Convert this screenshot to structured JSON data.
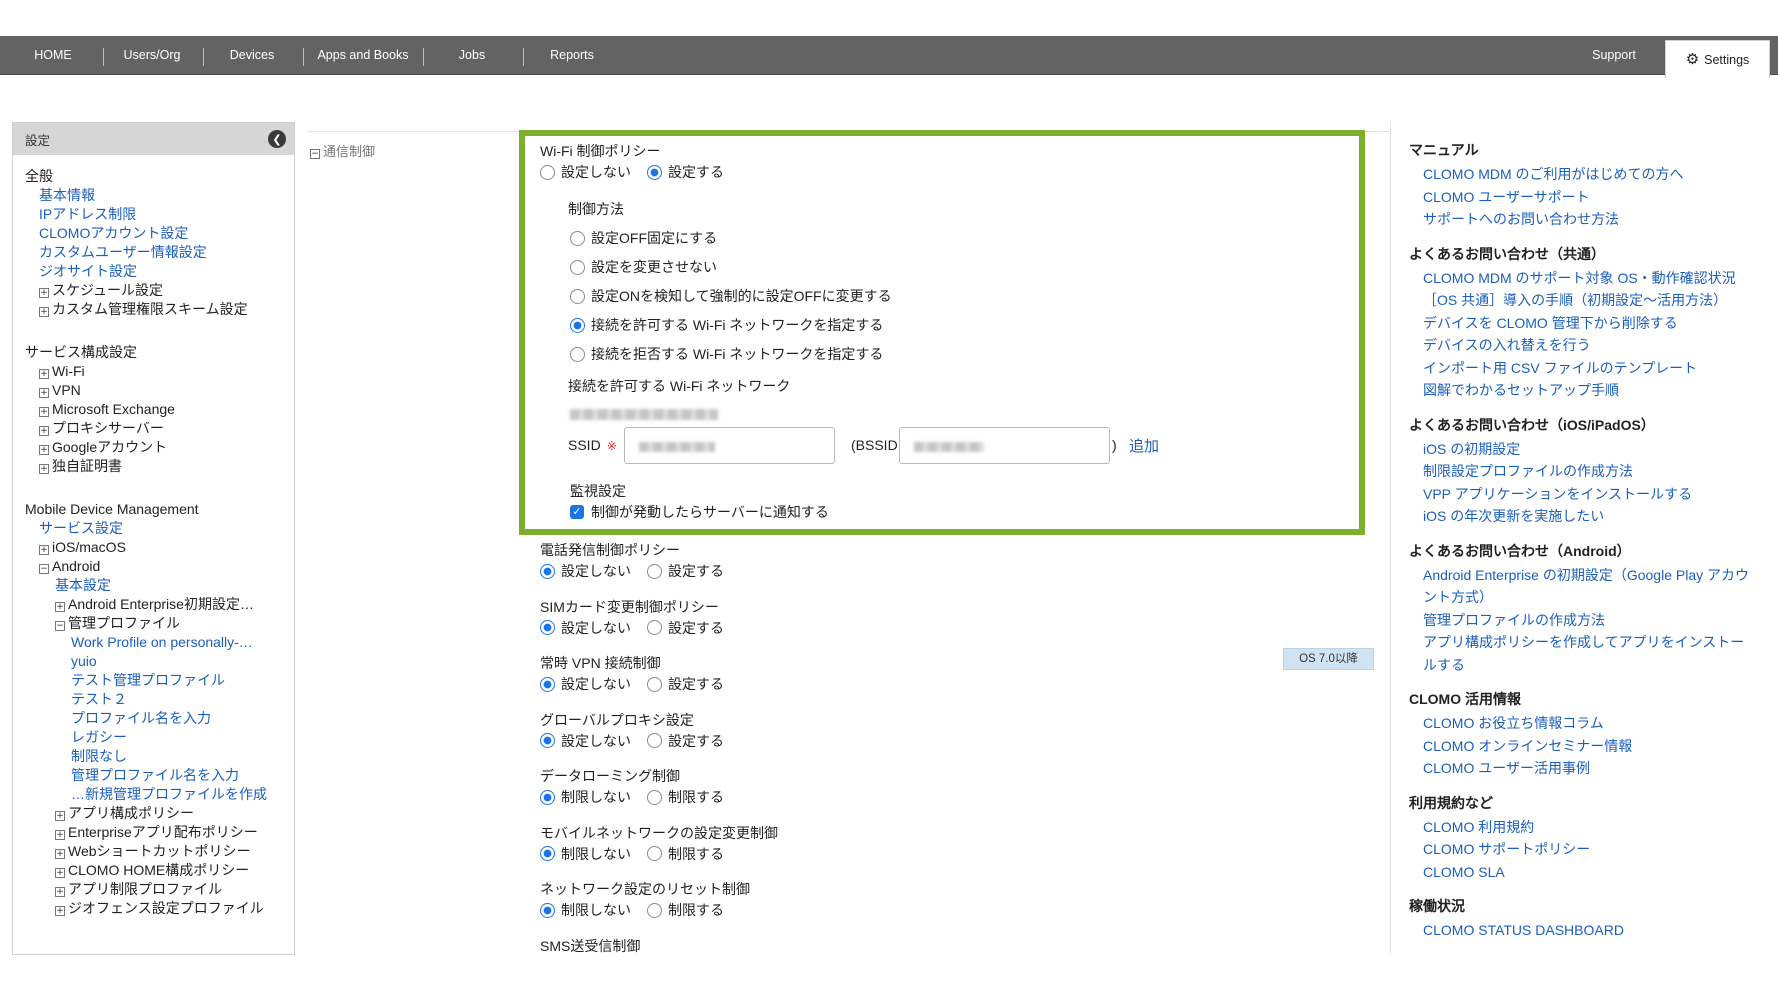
{
  "nav": {
    "items": [
      "HOME",
      "Users/Org",
      "Devices",
      "Apps and Books",
      "Jobs",
      "Reports"
    ],
    "support": "Support",
    "settings": "Settings"
  },
  "sidebar": {
    "title": "設定",
    "rows": [
      {
        "text": "全般",
        "indent": 0,
        "link": false,
        "pm": ""
      },
      {
        "text": "基本情報",
        "indent": 1,
        "link": true,
        "pm": ""
      },
      {
        "text": "IPアドレス制限",
        "indent": 1,
        "link": true,
        "pm": ""
      },
      {
        "text": "CLOMOアカウント設定",
        "indent": 1,
        "link": true,
        "pm": ""
      },
      {
        "text": "カスタムユーザー情報設定",
        "indent": 1,
        "link": true,
        "pm": ""
      },
      {
        "text": "ジオサイト設定",
        "indent": 1,
        "link": true,
        "pm": ""
      },
      {
        "text": "スケジュール設定",
        "indent": 1,
        "link": false,
        "pm": "+"
      },
      {
        "text": "カスタム管理権限スキーム設定",
        "indent": 1,
        "link": false,
        "pm": "+"
      },
      {
        "gap": true
      },
      {
        "text": "サービス構成設定",
        "indent": 0,
        "link": false,
        "pm": ""
      },
      {
        "text": "Wi-Fi",
        "indent": 1,
        "link": false,
        "pm": "+"
      },
      {
        "text": "VPN",
        "indent": 1,
        "link": false,
        "pm": "+"
      },
      {
        "text": "Microsoft Exchange",
        "indent": 1,
        "link": false,
        "pm": "+"
      },
      {
        "text": "プロキシサーバー",
        "indent": 1,
        "link": false,
        "pm": "+"
      },
      {
        "text": "Googleアカウント",
        "indent": 1,
        "link": false,
        "pm": "+"
      },
      {
        "text": "独自証明書",
        "indent": 1,
        "link": false,
        "pm": "+"
      },
      {
        "gap": true
      },
      {
        "text": "Mobile Device Management",
        "indent": 0,
        "link": false,
        "pm": ""
      },
      {
        "text": "サービス設定",
        "indent": 1,
        "link": true,
        "pm": ""
      },
      {
        "text": "iOS/macOS",
        "indent": 1,
        "link": false,
        "pm": "+"
      },
      {
        "text": "Android",
        "indent": 1,
        "link": false,
        "pm": "−"
      },
      {
        "text": "基本設定",
        "indent": 2,
        "link": true,
        "pm": ""
      },
      {
        "text": "Android Enterprise初期設定…",
        "indent": 2,
        "link": false,
        "pm": "+"
      },
      {
        "text": "管理プロファイル",
        "indent": 2,
        "link": false,
        "pm": "−"
      },
      {
        "text": "Work Profile on personally-…",
        "indent": 3,
        "link": true,
        "pm": ""
      },
      {
        "text": "yuio",
        "indent": 3,
        "link": true,
        "pm": ""
      },
      {
        "text": "テスト管理プロファイル",
        "indent": 3,
        "link": true,
        "pm": ""
      },
      {
        "text": "テスト２",
        "indent": 3,
        "link": true,
        "pm": ""
      },
      {
        "text": "プロファイル名を入力",
        "indent": 3,
        "link": true,
        "pm": ""
      },
      {
        "text": "レガシー",
        "indent": 3,
        "link": true,
        "pm": ""
      },
      {
        "text": "制限なし",
        "indent": 3,
        "link": true,
        "pm": ""
      },
      {
        "text": "管理プロファイル名を入力",
        "indent": 3,
        "link": true,
        "pm": ""
      },
      {
        "text": "…新規管理プロファイルを作成",
        "indent": 3,
        "link": true,
        "pm": ""
      },
      {
        "text": "アプリ構成ポリシー",
        "indent": 2,
        "link": false,
        "pm": "+"
      },
      {
        "text": "Enterpriseアプリ配布ポリシー",
        "indent": 2,
        "link": false,
        "pm": "+"
      },
      {
        "text": "Webショートカットポリシー",
        "indent": 2,
        "link": false,
        "pm": "+"
      },
      {
        "text": "CLOMO HOME構成ポリシー",
        "indent": 2,
        "link": false,
        "pm": "+"
      },
      {
        "text": "アプリ制限プロファイル",
        "indent": 2,
        "link": false,
        "pm": "+"
      },
      {
        "text": "ジオフェンス設定プロファイル",
        "indent": 2,
        "link": false,
        "pm": "+"
      }
    ]
  },
  "section": {
    "label": "通信制御"
  },
  "wifi": {
    "title": "Wi-Fi 制御ポリシー",
    "opt_off": "設定しない",
    "opt_on": "設定する",
    "method_label": "制御方法",
    "methods": [
      "設定OFF固定にする",
      "設定を変更させない",
      "設定ONを検知して強制的に設定OFFに変更する",
      "接続を許可する Wi-Fi ネットワークを指定する",
      "接続を拒否する Wi-Fi ネットワークを指定する"
    ],
    "selected_method": 3,
    "allowed_label": "接続を許可する Wi-Fi ネットワーク",
    "ssid_label": "SSID",
    "required_mark": "※",
    "bssid_label": "(BSSID",
    "close_paren": ")",
    "add_link": "追加",
    "monitor_label": "監視設定",
    "monitor_checkbox": "制御が発動したらサーバーに通知する"
  },
  "policies": [
    {
      "title": "電話発信制御ポリシー",
      "off": "設定しない",
      "on": "設定する"
    },
    {
      "title": "SIMカード変更制御ポリシー",
      "off": "設定しない",
      "on": "設定する"
    },
    {
      "title": "常時 VPN 接続制御",
      "off": "設定しない",
      "on": "設定する"
    },
    {
      "title": "グローバルプロキシ設定",
      "off": "設定しない",
      "on": "設定する"
    },
    {
      "title": "データローミング制御",
      "off": "制限しない",
      "on": "制限する"
    },
    {
      "title": "モバイルネットワークの設定変更制御",
      "off": "制限しない",
      "on": "制限する"
    },
    {
      "title": "ネットワーク設定のリセット制御",
      "off": "制限しない",
      "on": "制限する"
    },
    {
      "title": "SMS送受信制御",
      "off": "",
      "on": ""
    }
  ],
  "os_badge": "OS 7.0以降",
  "help": [
    {
      "title": "マニュアル",
      "links": [
        "CLOMO MDM のご利用がはじめての方へ",
        "CLOMO ユーザーサポート",
        "サポートへのお問い合わせ方法"
      ]
    },
    {
      "title": "よくあるお問い合わせ（共通）",
      "links": [
        "CLOMO MDM のサポート対象 OS・動作確認状況",
        "［OS 共通］導入の手順（初期設定～活用方法）",
        "デバイスを CLOMO 管理下から削除する",
        "デバイスの入れ替えを行う",
        "インポート用 CSV ファイルのテンプレート",
        "図解でわかるセットアップ手順"
      ]
    },
    {
      "title": "よくあるお問い合わせ（iOS/iPadOS）",
      "links": [
        "iOS の初期設定",
        "制限設定プロファイルの作成方法",
        "VPP アプリケーションをインストールする",
        "iOS の年次更新を実施したい"
      ]
    },
    {
      "title": "よくあるお問い合わせ（Android）",
      "links": [
        "Android Enterprise の初期設定（Google Play アカウント方式）",
        "管理プロファイルの作成方法",
        "アプリ構成ポリシーを作成してアプリをインストールする"
      ]
    },
    {
      "title": "CLOMO 活用情報",
      "links": [
        "CLOMO お役立ち情報コラム",
        "CLOMO オンラインセミナー情報",
        "CLOMO ユーザー活用事例"
      ]
    },
    {
      "title": "利用規約など",
      "links": [
        "CLOMO 利用規約",
        "CLOMO サポートポリシー",
        "CLOMO SLA"
      ]
    },
    {
      "title": "稼働状況",
      "links": [
        "CLOMO STATUS DASHBOARD"
      ]
    }
  ]
}
